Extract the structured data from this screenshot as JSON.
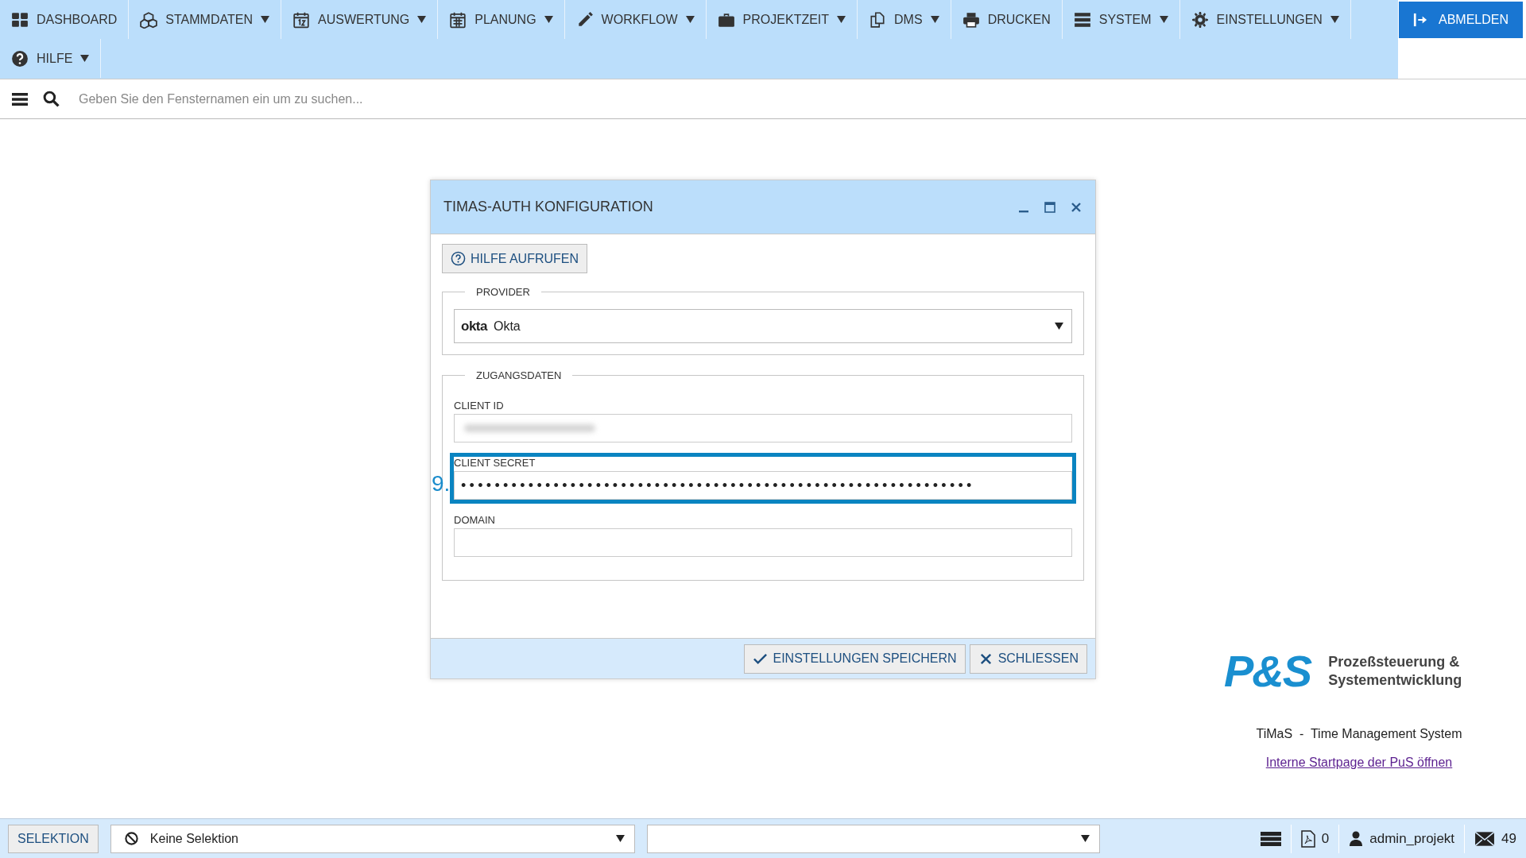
{
  "nav": {
    "items": [
      {
        "label": "DASHBOARD",
        "dropdown": false
      },
      {
        "label": "STAMMDATEN",
        "dropdown": true
      },
      {
        "label": "AUSWERTUNG",
        "dropdown": true
      },
      {
        "label": "PLANUNG",
        "dropdown": true
      },
      {
        "label": "WORKFLOW",
        "dropdown": true
      },
      {
        "label": "PROJEKTZEIT",
        "dropdown": true
      },
      {
        "label": "DMS",
        "dropdown": true
      },
      {
        "label": "DRUCKEN",
        "dropdown": false
      },
      {
        "label": "SYSTEM",
        "dropdown": true
      },
      {
        "label": "EINSTELLUNGEN",
        "dropdown": true
      },
      {
        "label": "HILFE",
        "dropdown": true
      }
    ],
    "logout": {
      "label": "ABMELDEN"
    }
  },
  "search": {
    "placeholder": "Geben Sie den Fensternamen ein um zu suchen..."
  },
  "dialog": {
    "title": "TIMAS-AUTH KONFIGURATION",
    "help_button": "HILFE AUFRUFEN",
    "provider": {
      "legend": "PROVIDER",
      "logo": "okta",
      "value": "Okta"
    },
    "credentials": {
      "legend": "ZUGANGSDATEN",
      "fields": [
        {
          "label": "CLIENT ID",
          "kind": "blurred",
          "highlighted": false
        },
        {
          "label": "CLIENT SECRET",
          "kind": "password",
          "value": "•••••••••••••••••••••••••••••••••••••••••••••••••••••••••••••",
          "highlighted": true,
          "annotation": "9."
        },
        {
          "label": "DOMAIN",
          "kind": "text",
          "highlighted": false
        }
      ]
    },
    "buttons": [
      {
        "label": "EINSTELLUNGEN SPEICHERN",
        "kind": "save"
      },
      {
        "label": "SCHLIESSEN",
        "kind": "close"
      }
    ]
  },
  "branding": {
    "logo_mark": "P&S",
    "company": "Prozeßsteuerung  &\nSystementwicklung",
    "product": "TiMaS  -  Time Management System",
    "link": "Interne Startpage der PuS öffnen"
  },
  "status_bar": {
    "selection_button": "SELEKTION",
    "selection": "Keine Selektion",
    "pdf_count": "0",
    "user": "admin_projekt",
    "mail_count": "49"
  }
}
